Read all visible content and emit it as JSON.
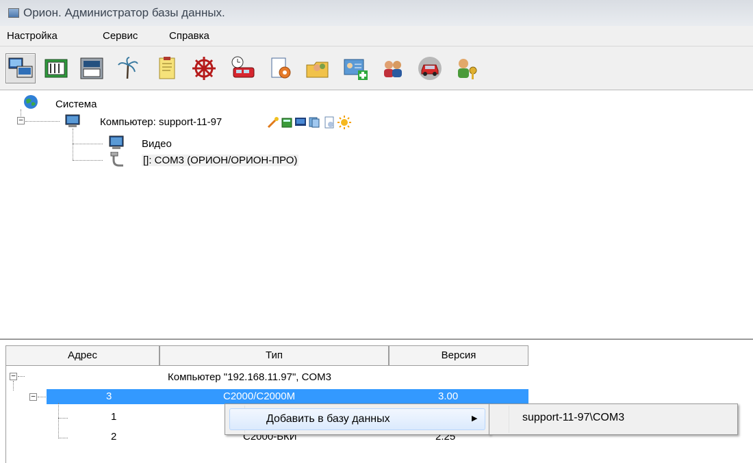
{
  "window": {
    "title": "Орион. Администратор базы данных."
  },
  "menu": [
    "Настройка",
    "Сервис",
    "Справка"
  ],
  "toolbar": {
    "icons": [
      "computers-icon",
      "devices-icon",
      "terminal-icon",
      "palm-tree-icon",
      "notes-icon",
      "wheel-icon",
      "schedule-train-icon",
      "document-gear-icon",
      "folder-users-icon",
      "add-card-icon",
      "users-icon",
      "car-icon",
      "user-key-icon"
    ]
  },
  "tree": {
    "root": "Система",
    "computer": "Компьютер: support-11-97",
    "children": [
      "Видео",
      "[]: COM3 (ОРИОН/ОРИОН-ПРО)"
    ]
  },
  "grid": {
    "columns": [
      "Адрес",
      "Тип",
      "Версия"
    ],
    "group": "Компьютер \"192.168.11.97\", COM3",
    "rows": [
      {
        "address": "3",
        "type": "С2000/С2000М",
        "version": "3.00",
        "selected": true
      },
      {
        "address": "1",
        "type": "",
        "version": ""
      },
      {
        "address": "2",
        "type": "С2000-БКИ",
        "version": "2.25"
      }
    ]
  },
  "context_menu": {
    "item": "Добавить в базу данных",
    "submenu_item": "support-11-97\\COM3"
  },
  "colors": {
    "selection": "#3399ff",
    "menu_highlight": "#dbeafd"
  }
}
